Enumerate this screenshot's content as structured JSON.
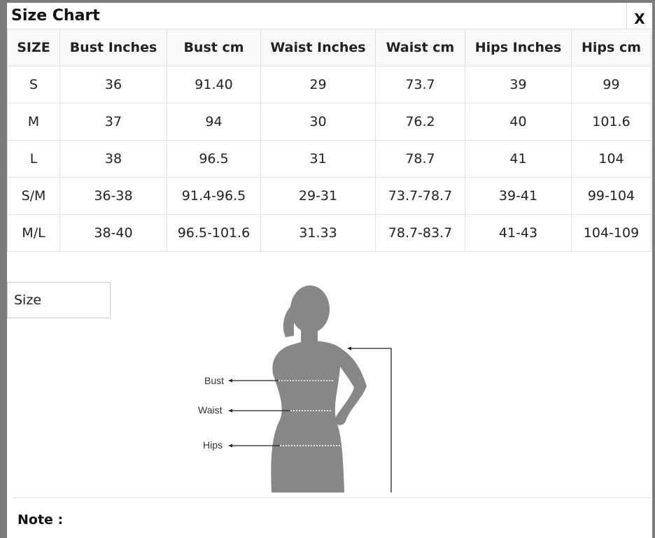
{
  "modal": {
    "title": "Size Chart",
    "close_label": "X"
  },
  "table": {
    "headers": [
      "SIZE",
      "Bust Inches",
      "Bust cm",
      "Waist Inches",
      "Waist cm",
      "Hips Inches",
      "Hips cm"
    ],
    "rows": [
      [
        "S",
        "36",
        "91.40",
        "29",
        "73.7",
        "39",
        "99"
      ],
      [
        "M",
        "37",
        "94",
        "30",
        "76.2",
        "40",
        "101.6"
      ],
      [
        "L",
        "38",
        "96.5",
        "31",
        "78.7",
        "41",
        "104"
      ],
      [
        "S/M",
        "36-38",
        "91.4-96.5",
        "29-31",
        "73.7-78.7",
        "39-41",
        "99-104"
      ],
      [
        "M/L",
        "38-40",
        "96.5-101.6",
        "31.33",
        "78.7-83.7",
        "41-43",
        "104-109"
      ]
    ]
  },
  "size_selector": {
    "value": "Size"
  },
  "figure": {
    "labels": {
      "bust": "Bust",
      "waist": "Waist",
      "hips": "Hips"
    },
    "silhouette_color": "#878787"
  },
  "note": {
    "label": "Note :"
  }
}
